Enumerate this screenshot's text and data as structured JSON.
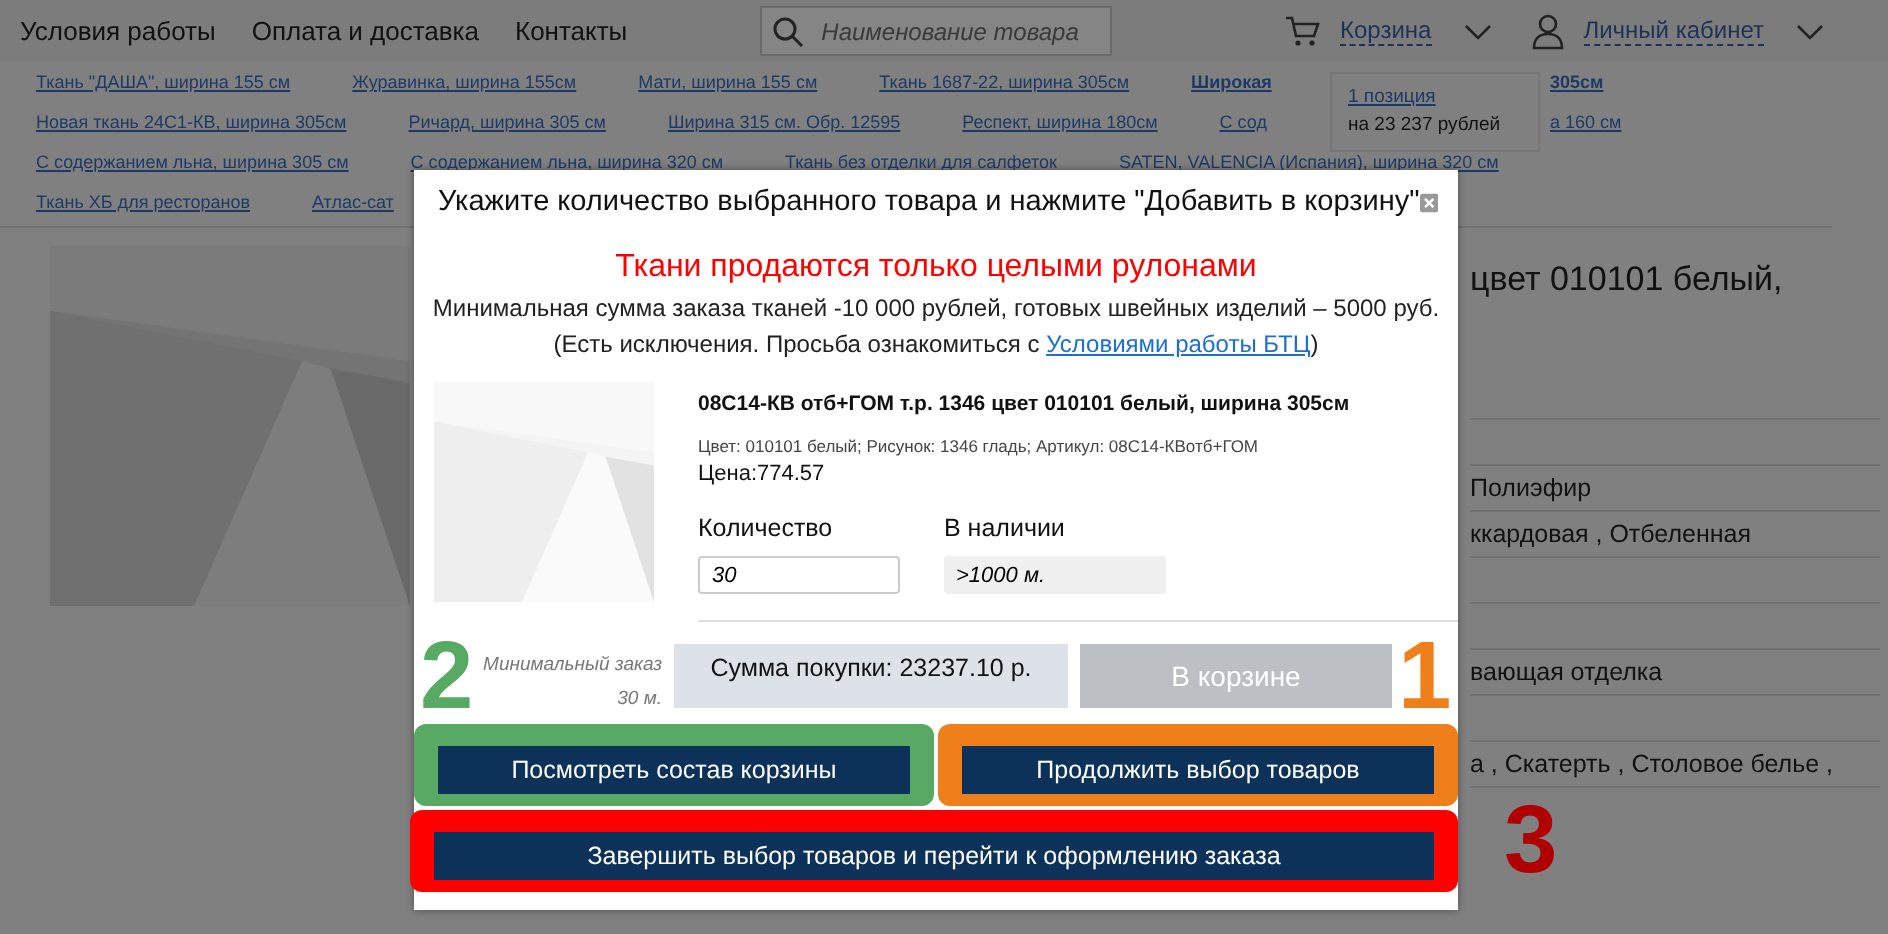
{
  "nav": {
    "links": [
      "Условия работы",
      "Оплата и доставка",
      "Контакты"
    ],
    "search": {
      "placeholder": "Наименование товара"
    },
    "cart": "Корзина",
    "account": "Личный кабинет"
  },
  "cart_popup": {
    "count": "1 позиция",
    "total": "на 23 237 рублей"
  },
  "category_links": [
    {
      "left": [
        {
          "text": "Ткань \"ДАША\", ширина 155 см",
          "bold": false
        },
        {
          "text": "Журавинка, ширина 155см",
          "bold": false
        },
        {
          "text": "Мати, ширина 155 см",
          "bold": false
        },
        {
          "text": "Ткань 1687-22, ширина 305см",
          "bold": false
        },
        {
          "text": "Широкая",
          "bold": true
        }
      ],
      "right": [
        {
          "text": "305см",
          "bold": true
        }
      ]
    },
    {
      "left": [
        {
          "text": "Новая ткань 24С1-КВ, ширина 305см",
          "bold": false
        },
        {
          "text": "Ричард, ширина 305 см",
          "bold": false
        },
        {
          "text": "Ширина 315 см. Обр. 12595",
          "bold": false
        },
        {
          "text": "Респект, ширина 180см",
          "bold": false
        },
        {
          "text": "С сод",
          "bold": false
        }
      ],
      "right": [
        {
          "text": "а 160 см",
          "bold": false
        }
      ]
    },
    {
      "left": [
        {
          "text": "С содержанием льна, ширина 305 см",
          "bold": false
        },
        {
          "text": "С содержанием льна, ширина 320 см",
          "bold": false
        },
        {
          "text": "Ткань без отделки для салфеток",
          "bold": false
        },
        {
          "text": "SATEN, VALENCIA (Испания), ширина 320 см",
          "bold": false
        }
      ]
    },
    {
      "left": [
        {
          "text": "Ткань ХБ для ресторанов",
          "bold": false
        },
        {
          "text": "Атлас-сат",
          "bold": false
        }
      ]
    }
  ],
  "product": {
    "title": "цвет 010101 белый,",
    "rows": [
      {
        "text": "Полиэфир"
      },
      {
        "text": "ккардовая , Отбеленная"
      },
      {
        "text": "вающая отделка"
      },
      {
        "text": "а , Скатерть , Столовое белье ,"
      }
    ]
  },
  "dialog": {
    "title": "Укажите количество выбранного товара и нажмите \"Добавить в корзину\"",
    "notice": "Ткани продаются только целыми рулонами",
    "info": "Минимальная сумма заказа тканей -10 000 рублей, готовых швейных изделий – 5000 руб.",
    "info_prefix": "(Есть исключения. Просьба ознакомиться с ",
    "info_link": "Условиями работы БТЦ",
    "info_suffix": ")",
    "item": {
      "name": "08С14-КВ отб+ГОМ т.р. 1346 цвет 010101 белый, ширина 305см",
      "meta": "Цвет: 010101 белый; Рисунок: 1346 гладь; Артикул: 08С14-КВотб+ГОМ",
      "price": "Цена:774.57"
    },
    "quantity": {
      "label": "Количество",
      "value": "30"
    },
    "stock": {
      "label": "В наличии",
      "value": ">1000 м."
    },
    "min_order": "Минимальный заказ 30 м.",
    "total": "Сумма покупки: 23237.10 р.",
    "add_button": {
      "label": "В корзине",
      "disabled": true
    },
    "actions": [
      {
        "label": "Посмотреть состав корзины",
        "color": "#58a964",
        "wide": false
      },
      {
        "label": "Продолжить выбор товаров",
        "color": "#ef7f1a",
        "wide": false
      },
      {
        "label": "Завершить выбор товаров и перейти к оформлению заказа",
        "color": "#ff0000",
        "wide": true
      }
    ],
    "annotations": [
      {
        "label": "2",
        "color": "#58a964",
        "kind": "left"
      },
      {
        "label": "1",
        "color": "#ef7f1a",
        "kind": "right"
      },
      {
        "label": "3",
        "color": "#b00000",
        "kind": "outside"
      }
    ]
  }
}
